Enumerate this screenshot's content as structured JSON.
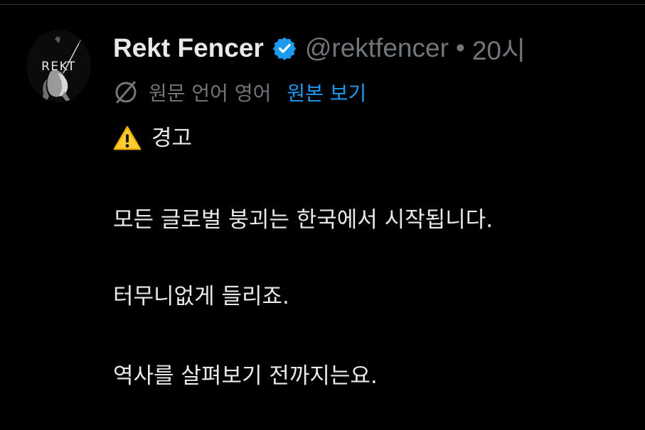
{
  "post": {
    "author": {
      "display_name": "Rekt Fencer",
      "handle": "@rektfencer",
      "avatar_text": "REKT",
      "verified_icon": "verified-badge-icon",
      "verified_color": "#1d9bf0"
    },
    "separator": "•",
    "timestamp": "20시",
    "translation": {
      "icon": "translate-icon",
      "label": "원문 언어 영어",
      "show_original": "원본 보기",
      "link_color": "#1d9bf0"
    },
    "body": {
      "warning_icon": "warning-icon",
      "warning_text": "경고",
      "line1": "모든 글로벌 붕괴는 한국에서 시작됩니다.",
      "line2": "터무니없게 들리죠.",
      "line3": "역사를 살펴보기 전까지는요."
    }
  }
}
